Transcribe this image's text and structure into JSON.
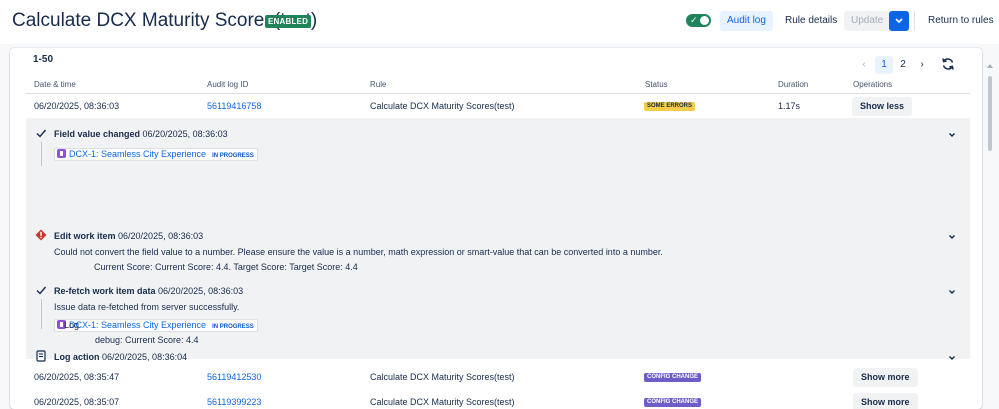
{
  "header": {
    "title": "Calculate DCX Maturity Scores(test)",
    "badge": "ENABLED",
    "audit_log": "Audit log",
    "rule_details": "Rule details",
    "update": "Update",
    "return": "Return to rules"
  },
  "colors": {
    "enabled": "#1f845a",
    "primary": "#0c66e4",
    "some_errors": "#f5cd47",
    "config_change": "#6e5dc6",
    "error_icon": "#c9372c"
  },
  "range": "1-50",
  "pagination": {
    "pages": [
      "1",
      "2"
    ],
    "current": "1"
  },
  "columns": {
    "date": "Date & time",
    "id": "Audit log ID",
    "rule": "Rule",
    "status": "Status",
    "duration": "Duration",
    "operations": "Operations"
  },
  "rows": [
    {
      "date": "06/20/2025, 08:36:03",
      "id": "56119416758",
      "rule": "Calculate DCX Maturity Scores(test)",
      "status": "SOME ERRORS",
      "duration": "1.17s",
      "action": "Show less"
    },
    {
      "date": "06/20/2025, 08:35:47",
      "id": "56119412530",
      "rule": "Calculate DCX Maturity Scores(test)",
      "status": "CONFIG CHANGE",
      "duration": "",
      "action": "Show more"
    },
    {
      "date": "06/20/2025, 08:35:07",
      "id": "56119399223",
      "rule": "Calculate DCX Maturity Scores(test)",
      "status": "CONFIG CHANGE",
      "duration": "",
      "action": "Show more"
    }
  ],
  "entries": [
    {
      "icon": "check-icon",
      "title": "Field value changed",
      "time": "06/20/2025, 08:36:03",
      "issue": {
        "key": "DCX-1: Seamless City Experience",
        "status": "IN PROGRESS"
      }
    },
    {
      "icon": "error-icon",
      "title": "Edit work item",
      "time": "06/20/2025, 08:36:03",
      "text": "Could not convert the field value to a number. Please ensure the value is a number, math expression or smart-value that can be converted into a number.",
      "detail": "Current Score: Current Score: 4.4. Target Score: Target Score: 4.4"
    },
    {
      "icon": "check-icon",
      "title": "Re-fetch work item data",
      "time": "06/20/2025, 08:36:03",
      "text": "Issue data re-fetched from server successfully.",
      "issue": {
        "key": "DCX-1: Seamless City Experience",
        "status": "IN PROGRESS"
      }
    },
    {
      "icon": "log-icon",
      "title": "Log action",
      "time": "06/20/2025, 08:36:04",
      "text": "Log",
      "detail": "debug: Current Score: 4.4"
    }
  ]
}
